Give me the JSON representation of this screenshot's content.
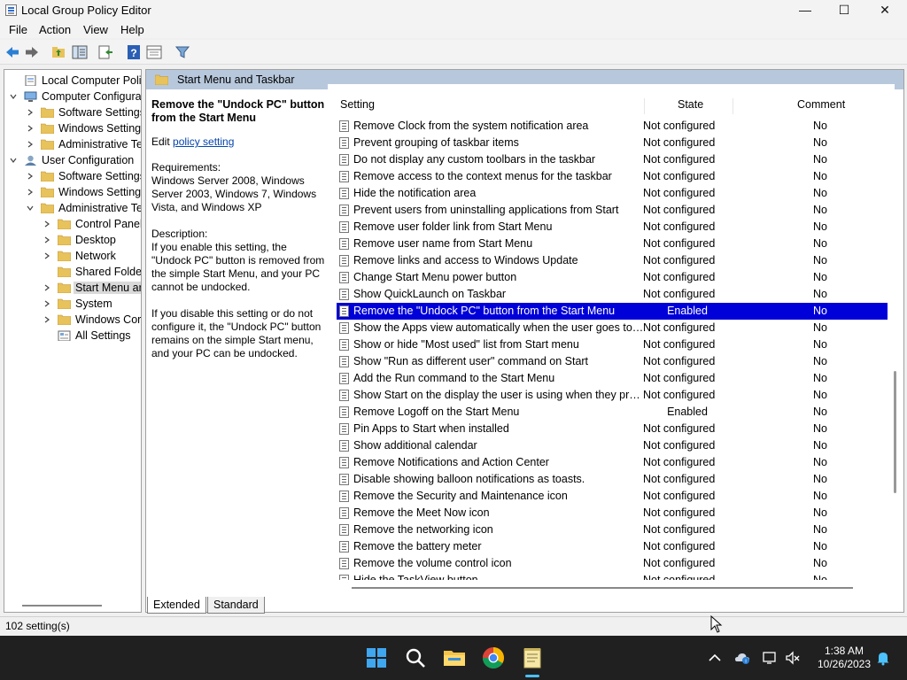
{
  "window": {
    "title": "Local Group Policy Editor",
    "controls": {
      "minimize": "—",
      "maximize": "☐",
      "close": "✕"
    }
  },
  "menubar": {
    "file": "File",
    "action": "Action",
    "view": "View",
    "help": "Help"
  },
  "tree": {
    "items": [
      {
        "label": "Local Computer Policy"
      },
      {
        "label": "Computer Configura"
      },
      {
        "label": "Software Settings"
      },
      {
        "label": "Windows Setting"
      },
      {
        "label": "Administrative Te"
      },
      {
        "label": "User Configuration"
      },
      {
        "label": "Software Settings"
      },
      {
        "label": "Windows Setting"
      },
      {
        "label": "Administrative Te"
      },
      {
        "label": "Control Panel"
      },
      {
        "label": "Desktop"
      },
      {
        "label": "Network"
      },
      {
        "label": "Shared Folder"
      },
      {
        "label": "Start Menu ar"
      },
      {
        "label": "System"
      },
      {
        "label": "Windows Cor"
      },
      {
        "label": "All Settings"
      }
    ]
  },
  "header": {
    "folder": "Start Menu and Taskbar"
  },
  "description": {
    "title": "Remove the \"Undock PC\" button from the Start Menu",
    "edit_prefix": "Edit",
    "edit_link": "policy setting",
    "requirements": "Requirements:\nWindows Server 2008, Windows Server 2003, Windows 7, Windows Vista, and Windows XP",
    "description_label": "Description:",
    "desc1": "If you enable this setting, the \"Undock PC\" button is removed from the simple Start Menu, and your PC cannot be undocked.",
    "desc2": "If you disable this setting or do not configure it, the \"Undock PC\" button remains on the simple Start menu, and your PC can be undocked."
  },
  "columns": {
    "setting": "Setting",
    "state": "State",
    "comment": "Comment"
  },
  "rows": [
    {
      "name": "Remove Clock from the system notification area",
      "state": "Not configured",
      "comment": "No"
    },
    {
      "name": "Prevent grouping of taskbar items",
      "state": "Not configured",
      "comment": "No"
    },
    {
      "name": "Do not display any custom toolbars in the taskbar",
      "state": "Not configured",
      "comment": "No"
    },
    {
      "name": "Remove access to the context menus for the taskbar",
      "state": "Not configured",
      "comment": "No"
    },
    {
      "name": "Hide the notification area",
      "state": "Not configured",
      "comment": "No"
    },
    {
      "name": "Prevent users from uninstalling applications from Start",
      "state": "Not configured",
      "comment": "No"
    },
    {
      "name": "Remove user folder link from Start Menu",
      "state": "Not configured",
      "comment": "No"
    },
    {
      "name": "Remove user name from Start Menu",
      "state": "Not configured",
      "comment": "No"
    },
    {
      "name": "Remove links and access to Windows Update",
      "state": "Not configured",
      "comment": "No"
    },
    {
      "name": "Change Start Menu power button",
      "state": "Not configured",
      "comment": "No"
    },
    {
      "name": "Show QuickLaunch on Taskbar",
      "state": "Not configured",
      "comment": "No"
    },
    {
      "name": "Remove the \"Undock PC\" button from the Start Menu",
      "state": "Enabled",
      "comment": "No"
    },
    {
      "name": "Show the Apps view automatically when the user goes to St...",
      "state": "Not configured",
      "comment": "No"
    },
    {
      "name": "Show or hide \"Most used\" list from Start menu",
      "state": "Not configured",
      "comment": "No"
    },
    {
      "name": "Show \"Run as different user\" command on Start",
      "state": "Not configured",
      "comment": "No"
    },
    {
      "name": "Add the Run command to the Start Menu",
      "state": "Not configured",
      "comment": "No"
    },
    {
      "name": "Show Start on the display the user is using when they press t...",
      "state": "Not configured",
      "comment": "No"
    },
    {
      "name": "Remove Logoff on the Start Menu",
      "state": "Enabled",
      "comment": "No"
    },
    {
      "name": "Pin Apps to Start when installed",
      "state": "Not configured",
      "comment": "No"
    },
    {
      "name": "Show additional calendar",
      "state": "Not configured",
      "comment": "No"
    },
    {
      "name": "Remove Notifications and Action Center",
      "state": "Not configured",
      "comment": "No"
    },
    {
      "name": "Disable showing balloon notifications as toasts.",
      "state": "Not configured",
      "comment": "No"
    },
    {
      "name": "Remove the Security and Maintenance icon",
      "state": "Not configured",
      "comment": "No"
    },
    {
      "name": "Remove the Meet Now icon",
      "state": "Not configured",
      "comment": "No"
    },
    {
      "name": "Remove the networking icon",
      "state": "Not configured",
      "comment": "No"
    },
    {
      "name": "Remove the battery meter",
      "state": "Not configured",
      "comment": "No"
    },
    {
      "name": "Remove the volume control icon",
      "state": "Not configured",
      "comment": "No"
    },
    {
      "name": "Hide the TaskView button",
      "state": "Not configured",
      "comment": "No"
    }
  ],
  "tabs": {
    "extended": "Extended",
    "standard": "Standard"
  },
  "status": {
    "text": "102 setting(s)"
  },
  "clock": {
    "time": "1:38 AM",
    "date": "10/26/2023"
  },
  "icons": {
    "back": "back-arrow-icon",
    "forward": "forward-arrow-icon",
    "up": "folder-up-icon",
    "show_hide": "show-hide-tree-icon",
    "export": "export-list-icon",
    "help": "help-icon",
    "properties": "properties-icon",
    "filter": "filter-icon"
  },
  "colors": {
    "selection": "#0000d8",
    "header_bar": "#b8c8dc",
    "taskbar": "#202020",
    "link": "#0645ad"
  }
}
